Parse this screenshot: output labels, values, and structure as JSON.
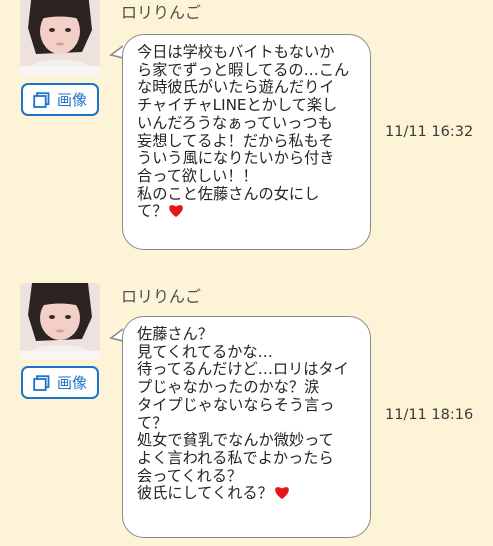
{
  "messages": [
    {
      "sender": "ロリりんご",
      "image_button_label": "画像",
      "text": "今日は学校もバイトもないか\nら家でずっと暇してるの…こん\nな時彼氏がいたら遊んだりイ\nチャイチャLINEとかして楽し\nいんだろうなぁっていっつも\n妄想してるよ！だから私もそ\nういう風になりたいから付き\n合って欲しい！！\n私のこと佐藤さんの女にし\nて？",
      "timestamp": "11/11 16:32",
      "emoji_icon": "heart-icon"
    },
    {
      "sender": "ロリりんご",
      "image_button_label": "画像",
      "text": "佐藤さん？\n見てくれてるかな…\n待ってるんだけど…ロリはタイ\nプじゃなかったのかな？涙\nタイプじゃないならそう言っ\nて？\n処女で貧乳でなんか微妙って\nよく言われる私でよかったら\n会ってくれる？\n彼氏にしてくれる？",
      "timestamp": "11/11 18:16",
      "emoji_icon": "heart-icon"
    }
  ],
  "colors": {
    "background": "#fdf3d6",
    "button_accent": "#1e73c8",
    "heart": "#e8141c",
    "bubble_border": "#8a8a8a"
  }
}
